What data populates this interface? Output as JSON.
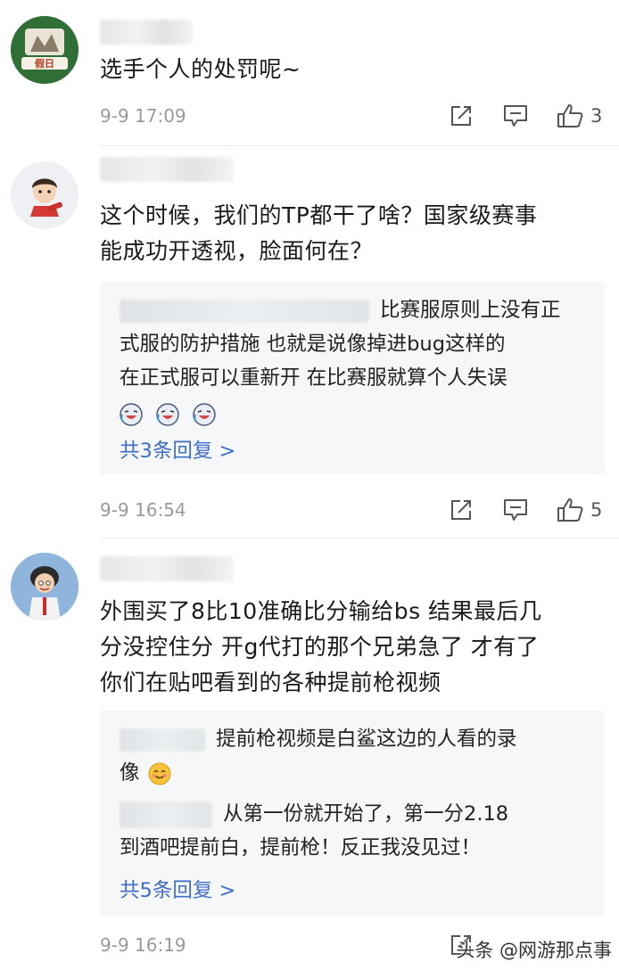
{
  "comments": [
    {
      "text": "选手个人的处罚呢~",
      "timestamp": "9-9 17:09",
      "likes": "3"
    },
    {
      "text_line1": "这个时候，我们的TP都干了啥？国家级赛事",
      "text_line2": "能成功开透视，脸面何在？",
      "reply_line1": "比赛服原则上没有正",
      "reply_line2": "式服的防护措施 也就是说像掉进bug这样的",
      "reply_line3": "在正式服可以重新开 在比赛服就算个人失误",
      "reply_count": "共3条回复 >",
      "timestamp": "9-9 16:54",
      "likes": "5"
    },
    {
      "text_line1": "外围买了8比10准确比分输给bs 结果最后几",
      "text_line2": "分没控住分 开g代打的那个兄弟急了 才有了",
      "text_line3": "你们在贴吧看到的各种提前枪视频",
      "reply1_line1": "提前枪视频是白鲨这边的人看的录",
      "reply1_line2": "像",
      "reply2_line1": "从第一份就开始了，第一分2.18",
      "reply2_line2": "到酒吧提前白，提前枪！反正我没见过！",
      "reply_count": "共5条回复 >",
      "timestamp": "9-9 16:19"
    }
  ],
  "watermark": "头条 @网游那点事",
  "icons": {
    "share": "share-icon",
    "comment": "comment-icon",
    "like": "thumbs-up-icon",
    "emoji": "laughing-emoji-icon",
    "smile": "smile-emoji-icon"
  },
  "colors": {
    "reply_link": "#3f6ec9",
    "timestamp": "#9a9a9a",
    "reply_bg": "#f6f7f8"
  }
}
